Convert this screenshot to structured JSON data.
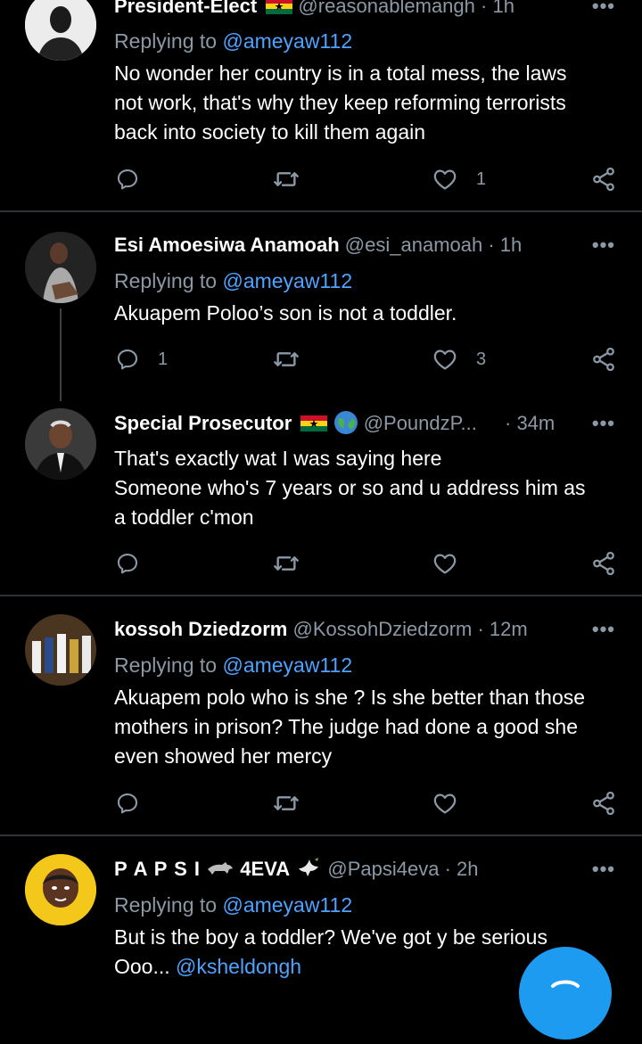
{
  "tweets": [
    {
      "name": "President-Elect",
      "handle": "@reasonablemangh",
      "time": "· 1h",
      "reply_prefix": "Replying to ",
      "reply_handle": "@ameyaw112",
      "lines": [
        "No wonder her country is in a total mess, the laws",
        "not work, that's why they keep reforming terrorists",
        "back into society to kill them again"
      ],
      "replies": "",
      "likes": "1"
    },
    {
      "name": "Esi Amoesiwa Anamoah",
      "handle": "@esi_anamoah",
      "time": "· 1h",
      "reply_prefix": "Replying to ",
      "reply_handle": "@ameyaw112",
      "lines": [
        "Akuapem Poloo’s son is not a toddler."
      ],
      "replies": "1",
      "likes": "3"
    },
    {
      "name": "Special Prosecutor",
      "handle": "@PoundzP...",
      "time": "· 34m",
      "lines": [
        "That's exactly wat I was saying here",
        "Someone who's 7 years or so and u address him as",
        "a toddler c'mon"
      ],
      "replies": "",
      "likes": ""
    },
    {
      "name": "kossoh Dziedzorm",
      "handle": "@KossohDziedzorm",
      "time": "· 12m",
      "reply_prefix": "Replying to ",
      "reply_handle": "@ameyaw112",
      "lines": [
        "Akuapem polo who is she ? Is she better than those",
        "mothers in prison? The judge had done a good she",
        "even showed her mercy"
      ],
      "replies": "",
      "likes": ""
    },
    {
      "name": "P A P S I",
      "name_suffix": "4EVA",
      "handle": "@Papsi4eva",
      "time": "· 2h",
      "reply_prefix": "Replying to ",
      "reply_handle": "@ameyaw112",
      "lines": [
        "But is the boy a toddler? We've got y be serious"
      ],
      "last_line_text": "Ooo... ",
      "last_line_mention": "@ksheldongh"
    }
  ],
  "more_label": "•••",
  "colors": {
    "accent": "#4da3ff",
    "muted": "#8b98a5",
    "background": "#000000",
    "fab": "#1d9bf0"
  },
  "icons": [
    "reply-icon",
    "retweet-icon",
    "like-icon",
    "share-icon",
    "more-icon",
    "ghana-flag-icon",
    "globe-icon",
    "dove-icon",
    "dog-icon",
    "compose-icon"
  ]
}
